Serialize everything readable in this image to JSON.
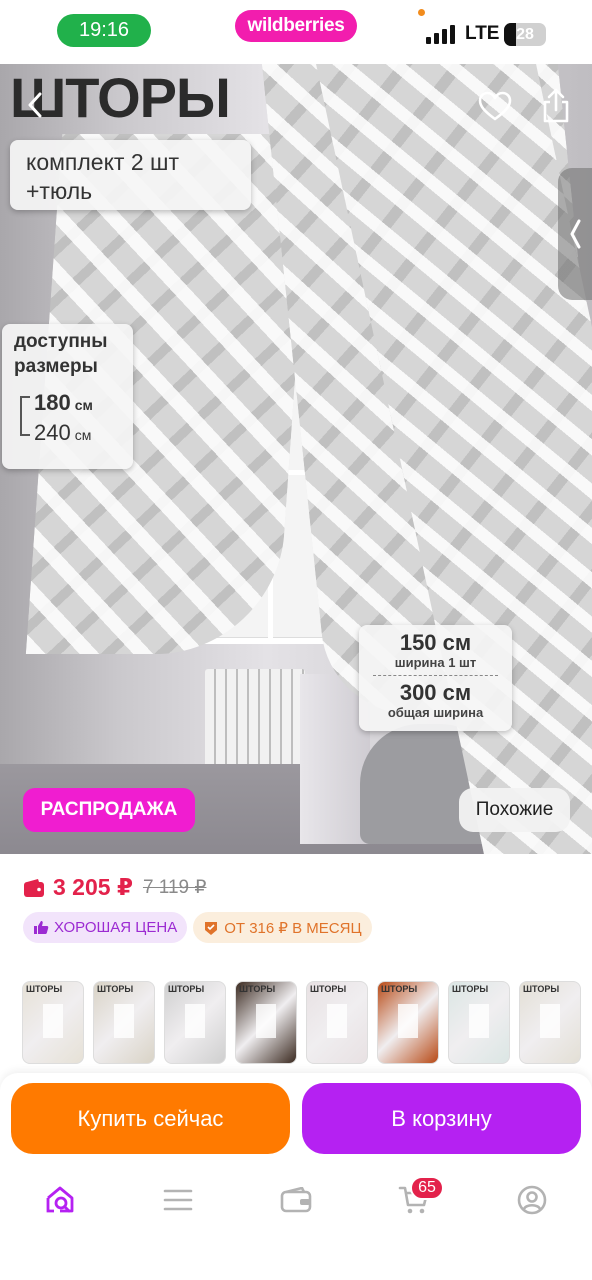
{
  "status_bar": {
    "time": "19:16",
    "brand": "wildberries",
    "network": "LTE",
    "battery": "28",
    "signal_bars": 4
  },
  "hero": {
    "title": "ШТОРЫ",
    "kit_line1": "комплект 2 шт",
    "kit_line2": "+тюль",
    "sizes_title_line1": "доступны",
    "sizes_title_line2": "размеры",
    "size_1_value": "180",
    "size_1_unit": "см",
    "size_2_value": "240",
    "size_2_unit": "см",
    "width_1_value": "150 см",
    "width_1_label": "ширина 1 шт",
    "width_total_value": "300 см",
    "width_total_label": "общая ширина",
    "sale_badge": "РАСПРОДАЖА",
    "similar_button": "Похожие"
  },
  "price": {
    "current": "3 205 ₽",
    "old": "7 119 ₽"
  },
  "chips": {
    "good_price": "ХОРОШАЯ ЦЕНА",
    "monthly": "ОТ 316 ₽ В МЕСЯЦ"
  },
  "thumbnails": {
    "title": "ШТОРЫ",
    "colors": [
      "#e6e1d6",
      "#d9d3c6",
      "#cfcfcf",
      "#3b2a20",
      "#e8e1e3",
      "#b84a16",
      "#dbe6e4",
      "#e3dfd5"
    ]
  },
  "actions": {
    "buy_now": "Купить сейчас",
    "add_to_cart": "В корзину"
  },
  "tab_bar": {
    "cart_count": "65",
    "active_color": "#b521f2",
    "inactive_color": "#b3b3b3"
  },
  "colors": {
    "green_time": "#21b14b",
    "brand_pink": "#f21dae",
    "price_red": "#e3224b",
    "buy_orange": "#ff7a00",
    "cart_purple": "#b521f2"
  }
}
